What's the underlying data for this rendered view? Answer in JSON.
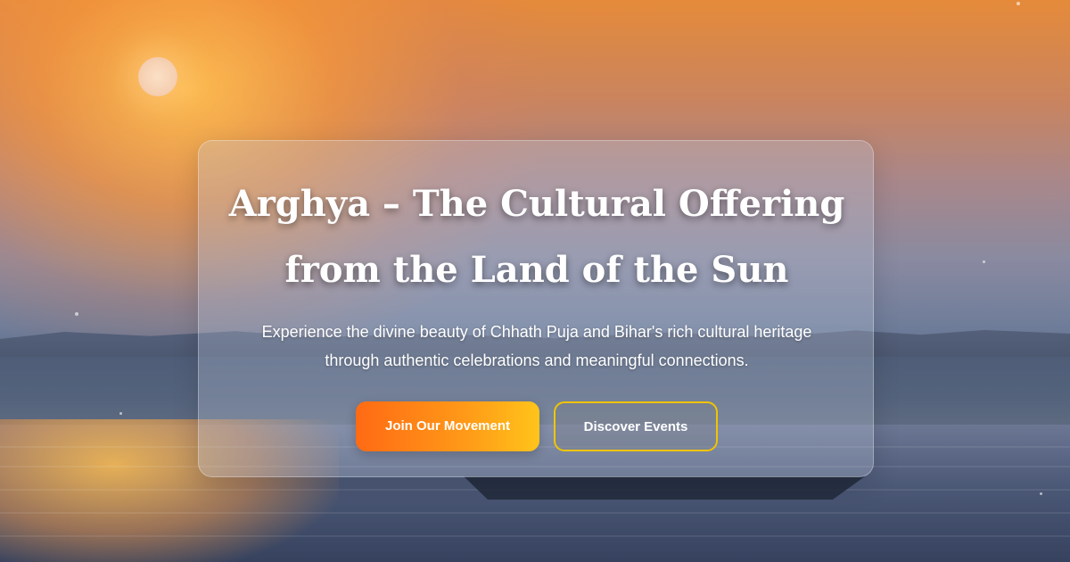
{
  "hero": {
    "title_line1": "Arghya – The Cultural Offering",
    "title_line2": "from the Land of the Sun",
    "subtitle_line1": "Experience the divine beauty of Chhath Puja and Bihar's rich cultural heritage",
    "subtitle_line2": "through authentic celebrations and meaningful connections.",
    "primary_button": "Join Our Movement",
    "secondary_button": "Discover Events"
  },
  "colors": {
    "primary_gradient_start": "#ff6a14",
    "primary_gradient_end": "#ffc41a",
    "secondary_border": "#f1c400",
    "text": "#ffffff"
  }
}
